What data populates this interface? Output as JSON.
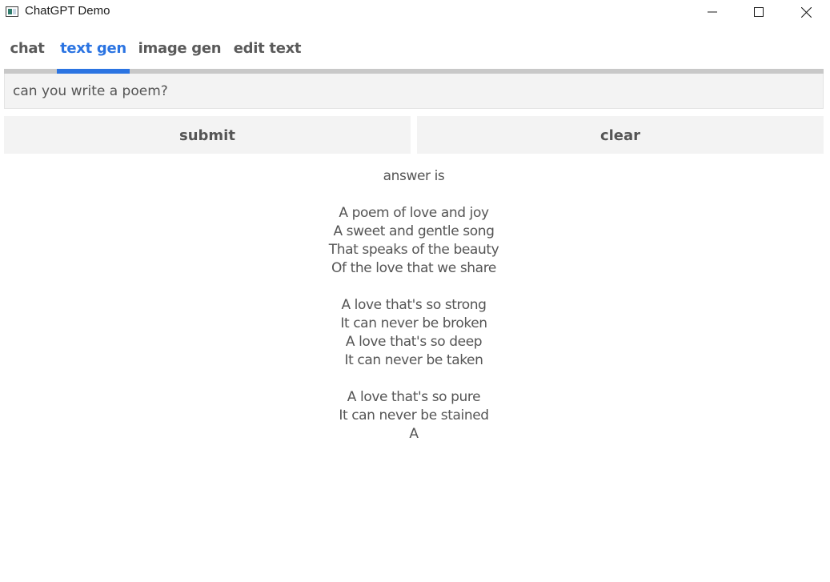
{
  "window": {
    "title": "ChatGPT Demo"
  },
  "tabs": [
    {
      "label": "chat"
    },
    {
      "label": "text gen"
    },
    {
      "label": "image gen"
    },
    {
      "label": "edit text"
    }
  ],
  "active_tab": "text gen",
  "accent_color": "#2b74e2",
  "prompt": {
    "value": "can you write a poem?"
  },
  "actions": {
    "submit_label": "submit",
    "clear_label": "clear"
  },
  "answer": {
    "lines": [
      "answer is",
      "",
      "A poem of love and joy",
      "A sweet and gentle song",
      "That speaks of the beauty",
      "Of the love that we share",
      "",
      "A love that's so strong",
      "It can never be broken",
      "A love that's so deep",
      "It can never be taken",
      "",
      "A love that's so pure",
      "It can never be stained",
      "A"
    ]
  }
}
